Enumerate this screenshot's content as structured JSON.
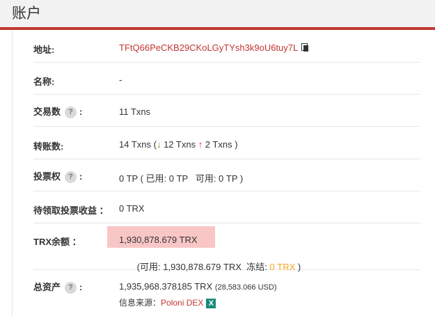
{
  "header": {
    "title": "账户"
  },
  "rows": {
    "address": {
      "label": "地址:",
      "value": "TFtQ66PeCKB29CKoLGyTYsh3k9oU6tuy7L"
    },
    "name": {
      "label": "名称:",
      "value": "-"
    },
    "txns": {
      "label": "交易数",
      "help": "?",
      "colon": ":",
      "value": "11 Txns"
    },
    "transfers": {
      "label": "转账数:",
      "prefix": "14 Txns (",
      "in_arrow": "↓",
      "in_text": " 12 Txns ",
      "out_arrow": "↑",
      "out_text": " 2 Txns )"
    },
    "votes": {
      "label": "投票权",
      "help": "?",
      "colon": ":",
      "value": "0 TP ( 已用: 0 TP   可用: 0 TP )"
    },
    "pending": {
      "label": "待领取投票收益 ：",
      "value": "0 TRX"
    },
    "trx_balance": {
      "label": "TRX余额 ：",
      "value": "1,930,878.679 TRX",
      "sub_prefix": "(可用: 1,930,878.679 TRX  冻结: ",
      "frozen": "0 TRX",
      "sub_suffix": " )"
    },
    "total_assets": {
      "label": "总资产",
      "help": "?",
      "colon": ":",
      "value": "1,935,968.378185 TRX",
      "usd": "(28,583.066 USD)",
      "source_label": "信息来源：",
      "source_link": "Poloni DEX",
      "source_icon": "X"
    }
  },
  "colors": {
    "accent": "#c23631",
    "highlight": "#f9c6c6",
    "frozen": "#f5a623"
  }
}
